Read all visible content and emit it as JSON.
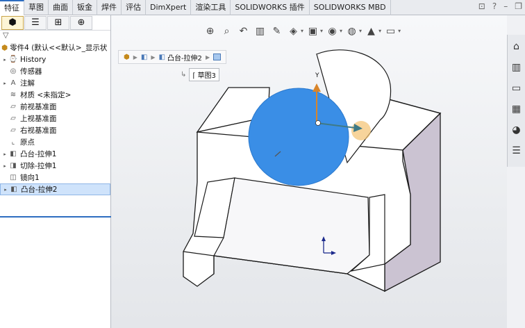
{
  "tabs": [
    "特征",
    "草图",
    "曲面",
    "钣金",
    "焊件",
    "评估",
    "DimXpert",
    "渲染工具",
    "SOLIDWORKS 插件",
    "SOLIDWORKS MBD"
  ],
  "active_tab_index": 0,
  "window_controls": [
    "⊡",
    "?",
    "–",
    "❐"
  ],
  "view_toolbar": {
    "icons": [
      "zoom-to-fit-icon",
      "zoom-to-area-icon",
      "previous-view-icon",
      "section-view-icon",
      "dynamic-annotation-icon",
      "view-orientation-icon",
      "display-style-icon",
      "hide-show-icon",
      "edit-appearance-icon",
      "apply-scene-icon",
      "view-settings-icon"
    ],
    "glyphs": [
      "⊕",
      "⌕",
      "↶",
      "▥",
      "✎",
      "◈",
      "▣",
      "◉",
      "◍",
      "▲",
      "▭"
    ]
  },
  "breadcrumb": {
    "item_label": "凸台-拉伸2",
    "sub_label": "草图3"
  },
  "left_panel": {
    "toolbar_icons": [
      "feature-manager-icon",
      "property-manager-icon",
      "configuration-manager-icon",
      "dimxpert-manager-icon"
    ],
    "toolbar_glyphs": [
      "⬢",
      "☰",
      "⊞",
      "⊕"
    ],
    "filter_glyph": "▽",
    "root_label": "零件4 (默认<<默认>_显示状",
    "items": [
      {
        "label": "History",
        "icon": "history-icon",
        "glyph": "⌚",
        "expander": "▸",
        "selected": false
      },
      {
        "label": "传感器",
        "icon": "sensor-icon",
        "glyph": "◎",
        "expander": "",
        "selected": false
      },
      {
        "label": "注解",
        "icon": "annotation-icon",
        "glyph": "A",
        "expander": "▸",
        "selected": false
      },
      {
        "label": "材质 <未指定>",
        "icon": "material-icon",
        "glyph": "≋",
        "expander": "",
        "selected": false
      },
      {
        "label": "前视基准面",
        "icon": "front-plane-icon",
        "glyph": "▱",
        "expander": "",
        "selected": false
      },
      {
        "label": "上视基准面",
        "icon": "top-plane-icon",
        "glyph": "▱",
        "expander": "",
        "selected": false
      },
      {
        "label": "右视基准面",
        "icon": "right-plane-icon",
        "glyph": "▱",
        "expander": "",
        "selected": false
      },
      {
        "label": "原点",
        "icon": "origin-icon",
        "glyph": "⌞",
        "expander": "",
        "selected": false
      },
      {
        "label": "凸台-拉伸1",
        "icon": "boss-extrude-icon",
        "glyph": "◧",
        "expander": "▸",
        "selected": false
      },
      {
        "label": "切除-拉伸1",
        "icon": "cut-extrude-icon",
        "glyph": "◨",
        "expander": "▸",
        "selected": false
      },
      {
        "label": "镜向1",
        "icon": "mirror-icon",
        "glyph": "◫",
        "expander": "",
        "selected": false
      },
      {
        "label": "凸台-拉伸2",
        "icon": "boss-extrude-icon",
        "glyph": "◧",
        "expander": "▸",
        "selected": true
      }
    ]
  },
  "triad_label": "Y",
  "task_pane": {
    "icons": [
      "home-icon",
      "design-library-icon",
      "file-explorer-icon",
      "view-palette-icon",
      "appearances-icon",
      "custom-properties-icon"
    ],
    "glyphs": [
      "⌂",
      "▥",
      "▭",
      "▦",
      "◕",
      "☰"
    ]
  }
}
